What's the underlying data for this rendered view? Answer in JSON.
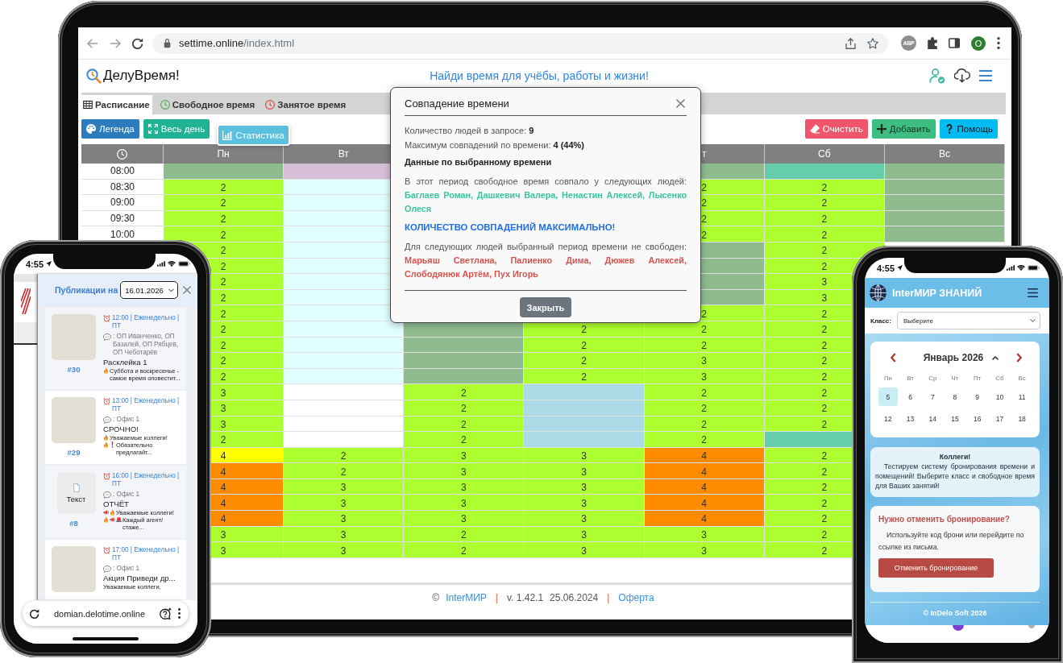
{
  "tablet": {
    "browser": {
      "url_host": "settime.online",
      "url_path": "/index.html",
      "extension_badge": "ABP",
      "profile_initial": "O"
    },
    "header": {
      "title": "ДелуВремя!",
      "tagline": "Найди время для учёбы, работы и жизни!"
    },
    "tabs": [
      {
        "label": "Расписание",
        "kind": "table",
        "selected": true
      },
      {
        "label": "Свободное время",
        "kind": "free",
        "selected": false
      },
      {
        "label": "Занятое время",
        "kind": "busy",
        "selected": false
      }
    ],
    "toolbar_left": [
      {
        "label": "Легенда",
        "kind": "legend",
        "pressed": false
      },
      {
        "label": "Весь день",
        "kind": "full-day",
        "pressed": false
      },
      {
        "label": "Статистика",
        "kind": "stats",
        "pressed": true
      }
    ],
    "toolbar_right": [
      {
        "label": "Очистить",
        "kind": "clear"
      },
      {
        "label": "Добавить",
        "kind": "add"
      },
      {
        "label": "Помощь",
        "kind": "help"
      }
    ],
    "schedule": {
      "columns": [
        "Пн",
        "Вт",
        null,
        null,
        "т",
        "Сб",
        "Вс"
      ],
      "rows": [
        {
          "time": "08:00",
          "cells": [
            {
              "color": "#8fbc8f"
            },
            {
              "color": "#d8bfd8"
            },
            null,
            null,
            {
              "color": "#8fbc8f"
            },
            {
              "color": "#66cdaa"
            },
            {
              "color": "#8fbc8f"
            }
          ]
        },
        {
          "time": "08:30",
          "cells": [
            {
              "text": "2",
              "color": "#adff2f"
            },
            {
              "color": "#e0ffff"
            },
            null,
            null,
            {
              "text": "2",
              "color": "#adff2f"
            },
            {
              "text": "2",
              "color": "#adff2f"
            },
            {
              "color": "#8fbc8f"
            }
          ]
        },
        {
          "time": "09:00",
          "cells": [
            {
              "text": "2",
              "color": "#adff2f"
            },
            {
              "color": "#e0ffff"
            },
            null,
            null,
            {
              "text": "2",
              "color": "#adff2f"
            },
            {
              "text": "2",
              "color": "#adff2f"
            },
            {
              "color": "#8fbc8f"
            }
          ]
        },
        {
          "time": "09:30",
          "cells": [
            {
              "text": "2",
              "color": "#adff2f"
            },
            {
              "color": "#e0ffff"
            },
            null,
            null,
            {
              "text": "2",
              "color": "#adff2f"
            },
            {
              "text": "2",
              "color": "#adff2f"
            },
            {
              "color": "#8fbc8f"
            }
          ]
        },
        {
          "time": "10:00",
          "cells": [
            {
              "text": "2",
              "color": "#adff2f"
            },
            {
              "color": "#e0ffff"
            },
            null,
            null,
            {
              "text": "2",
              "color": "#adff2f"
            },
            {
              "text": "2",
              "color": "#adff2f"
            },
            {
              "color": "#8fbc8f"
            }
          ]
        },
        {
          "cells": [
            {
              "text": "2",
              "color": "#adff2f"
            },
            {
              "color": "#e0ffff"
            },
            null,
            null,
            {
              "color": "#8fbc8f"
            },
            {
              "text": "2",
              "color": "#adff2f"
            },
            null
          ]
        },
        {
          "cells": [
            {
              "text": "2",
              "color": "#adff2f"
            },
            {
              "color": "#e0ffff"
            },
            null,
            null,
            {
              "color": "#8fbc8f"
            },
            {
              "text": "2",
              "color": "#adff2f"
            },
            null
          ]
        },
        {
          "cells": [
            {
              "text": "2",
              "color": "#adff2f"
            },
            {
              "color": "#e0ffff"
            },
            null,
            null,
            {
              "color": "#8fbc8f"
            },
            {
              "text": "3",
              "color": "#adff2f"
            },
            null
          ]
        },
        {
          "cells": [
            {
              "text": "2",
              "color": "#adff2f"
            },
            {
              "color": "#e0ffff"
            },
            null,
            null,
            {
              "color": "#8fbc8f"
            },
            {
              "text": "3",
              "color": "#adff2f"
            },
            null
          ]
        },
        {
          "cells": [
            {
              "text": "2",
              "color": "#adff2f"
            },
            {
              "color": "#e0ffff"
            },
            null,
            null,
            {
              "text": "2",
              "color": "#adff2f"
            },
            {
              "text": "2",
              "color": "#adff2f"
            },
            null
          ]
        },
        {
          "cells": [
            {
              "text": "2",
              "color": "#adff2f"
            },
            {
              "color": "#e0ffff"
            },
            {
              "color": "#8fbc8f"
            },
            {
              "text": "2",
              "color": "#adff2f"
            },
            {
              "text": "2",
              "color": "#adff2f"
            },
            {
              "text": "2",
              "color": "#adff2f"
            },
            null
          ]
        },
        {
          "cells": [
            {
              "text": "2",
              "color": "#adff2f"
            },
            {
              "color": "#e0ffff"
            },
            {
              "color": "#8fbc8f"
            },
            {
              "text": "2",
              "color": "#adff2f"
            },
            {
              "text": "2",
              "color": "#adff2f"
            },
            {
              "text": "2",
              "color": "#adff2f"
            },
            null
          ]
        },
        {
          "cells": [
            {
              "text": "2",
              "color": "#adff2f"
            },
            {
              "color": "#e0ffff"
            },
            {
              "color": "#8fbc8f"
            },
            {
              "text": "2",
              "color": "#adff2f"
            },
            {
              "text": "3",
              "color": "#adff2f"
            },
            {
              "text": "2",
              "color": "#adff2f"
            },
            null
          ]
        },
        {
          "cells": [
            {
              "text": "2",
              "color": "#adff2f"
            },
            {
              "color": "#e0ffff"
            },
            {
              "color": "#8fbc8f"
            },
            {
              "text": "2",
              "color": "#adff2f"
            },
            {
              "text": "3",
              "color": "#adff2f"
            },
            {
              "text": "2",
              "color": "#adff2f"
            },
            null
          ]
        },
        {
          "cells": [
            {
              "text": "3",
              "color": "#adff2f"
            },
            {
              "color": "#ffffff"
            },
            {
              "text": "2",
              "color": "#adff2f"
            },
            {
              "color": "#add8e6"
            },
            {
              "text": "2",
              "color": "#adff2f"
            },
            {
              "text": "2",
              "color": "#adff2f"
            },
            null
          ]
        },
        {
          "cells": [
            {
              "text": "3",
              "color": "#adff2f"
            },
            {
              "color": "#ffffff"
            },
            {
              "text": "2",
              "color": "#adff2f"
            },
            {
              "color": "#add8e6"
            },
            {
              "text": "2",
              "color": "#adff2f"
            },
            {
              "text": "2",
              "color": "#adff2f"
            },
            null
          ]
        },
        {
          "cells": [
            {
              "text": "3",
              "color": "#adff2f"
            },
            {
              "color": "#ffffff"
            },
            {
              "text": "2",
              "color": "#adff2f"
            },
            {
              "color": "#add8e6"
            },
            {
              "text": "2",
              "color": "#adff2f"
            },
            {
              "text": "2",
              "color": "#adff2f"
            },
            null
          ]
        },
        {
          "cells": [
            {
              "text": "2",
              "color": "#adff2f"
            },
            {
              "color": "#ffffff"
            },
            {
              "text": "2",
              "color": "#adff2f"
            },
            {
              "color": "#add8e6"
            },
            {
              "text": "2",
              "color": "#adff2f"
            },
            {
              "color": "#66cdaa"
            },
            null
          ]
        },
        {
          "cells": [
            {
              "text": "4",
              "color": "#ffff00"
            },
            {
              "text": "2",
              "color": "#adff2f"
            },
            {
              "text": "3",
              "color": "#adff2f"
            },
            {
              "text": "3",
              "color": "#adff2f"
            },
            {
              "text": "4",
              "color": "#ff8c00"
            },
            {
              "text": "2",
              "color": "#adff2f"
            },
            null
          ]
        },
        {
          "cells": [
            {
              "text": "4",
              "color": "#ff8c00"
            },
            {
              "text": "2",
              "color": "#adff2f"
            },
            {
              "text": "3",
              "color": "#adff2f"
            },
            {
              "text": "3",
              "color": "#adff2f"
            },
            {
              "text": "4",
              "color": "#ff8c00"
            },
            {
              "text": "2",
              "color": "#adff2f"
            },
            null
          ]
        },
        {
          "cells": [
            {
              "text": "4",
              "color": "#ff8c00"
            },
            {
              "text": "3",
              "color": "#adff2f"
            },
            {
              "text": "3",
              "color": "#adff2f"
            },
            {
              "text": "3",
              "color": "#adff2f"
            },
            {
              "text": "4",
              "color": "#ff8c00"
            },
            {
              "text": "2",
              "color": "#adff2f"
            },
            null
          ]
        },
        {
          "cells": [
            {
              "text": "4",
              "color": "#ff8c00"
            },
            {
              "text": "3",
              "color": "#adff2f"
            },
            {
              "text": "3",
              "color": "#adff2f"
            },
            {
              "text": "3",
              "color": "#adff2f"
            },
            {
              "text": "4",
              "color": "#ff8c00"
            },
            {
              "text": "2",
              "color": "#adff2f"
            },
            null
          ]
        },
        {
          "cells": [
            {
              "text": "4",
              "color": "#ff8c00"
            },
            {
              "text": "3",
              "color": "#adff2f"
            },
            {
              "text": "3",
              "color": "#adff2f"
            },
            {
              "text": "3",
              "color": "#adff2f"
            },
            {
              "text": "4",
              "color": "#ff8c00"
            },
            {
              "text": "2",
              "color": "#adff2f"
            },
            null
          ]
        },
        {
          "cells": [
            {
              "text": "3",
              "color": "#adff2f"
            },
            {
              "text": "3",
              "color": "#adff2f"
            },
            {
              "text": "2",
              "color": "#adff2f"
            },
            {
              "text": "3",
              "color": "#adff2f"
            },
            {
              "text": "3",
              "color": "#adff2f"
            },
            {
              "text": "2",
              "color": "#adff2f"
            },
            null
          ]
        },
        {
          "cells": [
            {
              "text": "3",
              "color": "#adff2f"
            },
            {
              "text": "3",
              "color": "#adff2f"
            },
            {
              "text": "2",
              "color": "#adff2f"
            },
            {
              "text": "3",
              "color": "#adff2f"
            },
            {
              "text": "3",
              "color": "#adff2f"
            },
            {
              "text": "2",
              "color": "#adff2f"
            },
            null
          ]
        }
      ]
    },
    "modal": {
      "title": "Совпадение времени",
      "stats": [
        "Количество людей в запросе: **9**",
        "Максимум совпадений по времени: **4 (44%)**"
      ],
      "section_title": "Данные по выбранному времени",
      "free_intro": "В этот период свободное время совпало у следующих людей:",
      "free_people": "Баглаев Роман, Дашкевич Валера, Ненастин Алексей, Лысенко Олеся",
      "notice": "КОЛИЧЕСТВО СОВПАДЕНИЙ МАКСИМАЛЬНО!",
      "busy_intro": "Для следующих людей выбранный период времени не свободен:",
      "busy_people": "Марьяш Светлана, Палиенко Дима, Дюжев Алексей, Слободянюк Артём, Пух Игорь",
      "close_button": "Закрыть"
    },
    "footer": [
      {
        "kind": "text",
        "text": "©"
      },
      {
        "kind": "link",
        "text": "InterМИР"
      },
      {
        "kind": "separator",
        "text": "|"
      },
      {
        "kind": "text",
        "text": "v. 1.42.1"
      },
      {
        "kind": "text",
        "text": "25.06.2024"
      },
      {
        "kind": "separator",
        "text": "|"
      },
      {
        "kind": "link",
        "text": "Оферта"
      }
    ]
  },
  "left_phone": {
    "time": "4:55",
    "panel": {
      "title": "Публикации на",
      "date": "16.01.2026",
      "items": [
        {
          "image": {
            "kind": "picture"
          },
          "id": "#30",
          "schedule": "12:00 | Еженедельно | ПТ",
          "recipients": ": ОП Иванченко, ОП Базалей, ОП Рябцев, ОП Чеботарёв",
          "title": "Расклейка 1",
          "description": [
            {
              "kind": "fire"
            },
            {
              "kind": "text",
              "text": "Суббота и воскресенье - самое время оповестит..."
            }
          ]
        },
        {
          "image": {
            "kind": "picture"
          },
          "id": "#29",
          "schedule": "13:00 | Еженедельно | ПТ",
          "recipients": ": Офис 1",
          "title": "СРОЧНО!",
          "description": [
            {
              "kind": "fire"
            },
            {
              "kind": "text",
              "text": "Уважаемые коллеги!"
            },
            {
              "kind": "fire"
            },
            {
              "kind": "exclamation"
            },
            {
              "kind": "text",
              "text": "Обязательно предлагайт..."
            }
          ]
        },
        {
          "image": {
            "kind": "text",
            "label": "Текст"
          },
          "id": "#8",
          "schedule": "16:00 | Еженедельно | ПТ",
          "recipients": ": Офис 1",
          "title": "ОТЧЁТ",
          "description": [
            {
              "kind": "megaphone"
            },
            {
              "kind": "fire"
            },
            {
              "kind": "text",
              "text": "Уважаемые коллеги!"
            },
            {
              "kind": "fire"
            },
            {
              "kind": "megaphone"
            },
            {
              "kind": "siren"
            },
            {
              "kind": "text",
              "text": "Каждый агент/стаже..."
            }
          ]
        },
        {
          "image": {
            "kind": "picture"
          },
          "schedule": "17:00 | Еженедельно | ПТ",
          "recipients": ": Офис 1",
          "title": "Акция Приведи др...",
          "description": [
            {
              "kind": "text",
              "text": "Уважаемые коллеги,"
            }
          ]
        }
      ]
    },
    "address": "domian.delotime.online"
  },
  "right_phone": {
    "time": "4:55",
    "brand": "InterМИР ЗНАНИЙ",
    "class_label": "Класс:",
    "class_value": "Выберите",
    "calendar": {
      "month": "Январь 2026",
      "weekdays": [
        "Пн",
        "Вт",
        "Ср",
        "Чт",
        "Пт",
        "Сб",
        "Вс"
      ],
      "weeks": [
        [
          {
            "day": "5",
            "selected": true
          },
          {
            "day": "6",
            "selected": false
          },
          {
            "day": "7",
            "selected": false
          },
          {
            "day": "8",
            "selected": false
          },
          {
            "day": "9",
            "selected": false
          },
          {
            "day": "10",
            "selected": false
          },
          {
            "day": "11",
            "selected": false
          }
        ],
        [
          {
            "day": "12",
            "selected": false
          },
          {
            "day": "13",
            "selected": false
          },
          {
            "day": "14",
            "selected": false
          },
          {
            "day": "15",
            "selected": false
          },
          {
            "day": "16",
            "selected": false
          },
          {
            "day": "17",
            "selected": false
          },
          {
            "day": "18",
            "selected": false
          }
        ]
      ]
    },
    "notice": {
      "title": "Коллеги!",
      "text": "Тестируем систему бронирования времени и помещений! Выберите класс и свободное время для Ваших занятий!"
    },
    "cancel": {
      "title": "Нужно отменить бронирование?",
      "text": "Используйте код брони или перейдите по ссылке из письма.",
      "button": "Отменить бронирование"
    },
    "footer": "© InDelo Soft 2026"
  }
}
